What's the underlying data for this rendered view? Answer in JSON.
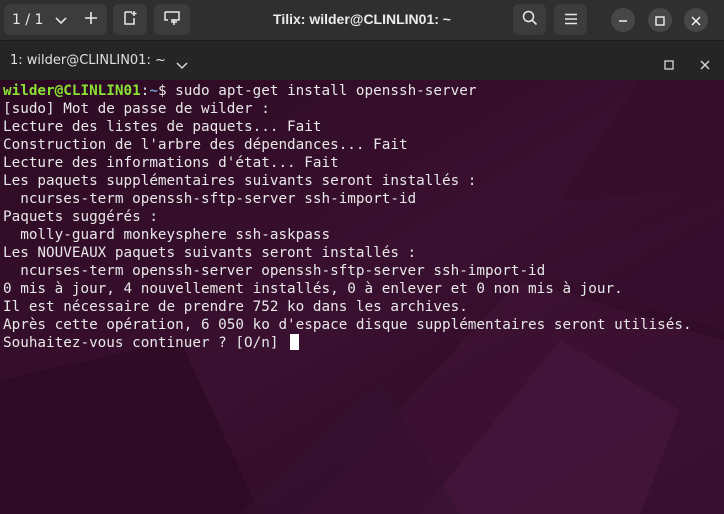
{
  "header": {
    "session_counter": "1 / 1",
    "window_title": "Tilix: wilder@CLINLIN01: ~"
  },
  "tab": {
    "title": "1: wilder@CLINLIN01: ~"
  },
  "terminal": {
    "prompt_user": "wilder@CLINLIN01",
    "prompt_sep": ":",
    "prompt_path": "~",
    "prompt_symbol": "$ ",
    "command": "sudo apt-get install openssh-server",
    "lines": [
      "[sudo] Mot de passe de wilder :",
      "Lecture des listes de paquets... Fait",
      "Construction de l'arbre des dépendances... Fait",
      "Lecture des informations d'état... Fait",
      "Les paquets supplémentaires suivants seront installés :",
      "  ncurses-term openssh-sftp-server ssh-import-id",
      "Paquets suggérés :",
      "  molly-guard monkeysphere ssh-askpass",
      "Les NOUVEAUX paquets suivants seront installés :",
      "  ncurses-term openssh-server openssh-sftp-server ssh-import-id",
      "0 mis à jour, 4 nouvellement installés, 0 à enlever et 0 non mis à jour.",
      "Il est nécessaire de prendre 752 ko dans les archives.",
      "Après cette opération, 6 050 ko d'espace disque supplémentaires seront utilisés."
    ],
    "final_prompt": "Souhaitez-vous continuer ? [O/n] "
  },
  "colors": {
    "terminal_bg": "#300a24",
    "user_green": "#8ae234",
    "path_blue": "#729fcf"
  },
  "icons": [
    "chevron-down-icon",
    "plus-icon",
    "detach-terminal-icon",
    "sync-input-icon",
    "search-icon",
    "hamburger-menu-icon",
    "minimize-icon",
    "maximize-icon",
    "close-icon"
  ]
}
